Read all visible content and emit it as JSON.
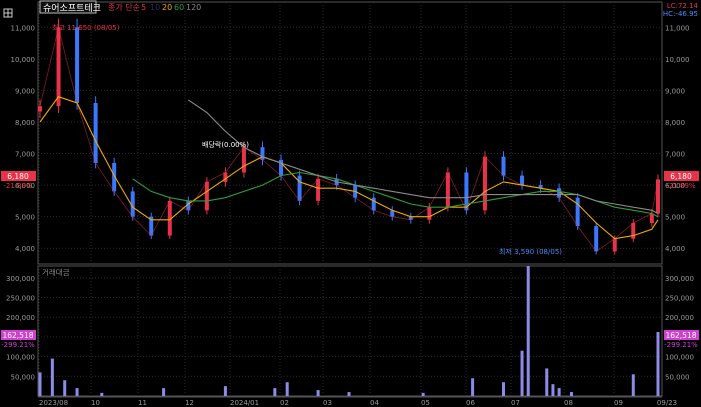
{
  "colors": {
    "background": "#000000",
    "panel_border": "#555555",
    "grid": "#2a2a2a",
    "axis_text": "#9a9a9a",
    "up": "#e8324a",
    "down": "#3a78ff",
    "ma5": "#e8324a",
    "ma20": "#f2a900",
    "ma60": "#2e9d3a",
    "ma120": "#8a8a8a",
    "volume": "#8c8ce8",
    "current_box": "#e8324a",
    "volume_box": "#d040d0",
    "high_label": "#e8324a",
    "low_label": "#4d8cff",
    "dividend_label": "#ffffff"
  },
  "header": {
    "icon": "grid-icon",
    "stock_name": "슈어소프트테크",
    "ma_caption": "종가 단순",
    "ma_periods": [
      "5",
      "10",
      "20",
      "60",
      "120"
    ],
    "lc_label": "LC:72.14",
    "hc_label": "HC:-46.95"
  },
  "price_panel": {
    "current_price_label": "6,180",
    "current_change_label": "-21.89%",
    "high_annotation": "최고 11,650 (08/05)",
    "low_annotation": "최저 3,590 (08/05)",
    "dividend_annotation": "배당락(0.00%)"
  },
  "volume_panel": {
    "title": "거래대금",
    "current_volume_label": "162,518",
    "current_volume_change": "-299.21%"
  },
  "chart_data": [
    {
      "type": "line",
      "title": "",
      "ylim": [
        3500,
        11800
      ],
      "y_ticks": [
        "4,000",
        "5,000",
        "6,000",
        "7,000",
        "8,000",
        "9,000",
        "10,000",
        "11,000"
      ],
      "x_ticks": [
        "2023/08",
        "10",
        "11",
        "12",
        "2024/01",
        "02",
        "03",
        "04",
        "05",
        "06",
        "07",
        "08",
        "09",
        "09/23"
      ],
      "x": [
        0,
        3,
        6,
        9,
        12,
        15,
        18,
        21,
        24,
        27,
        30,
        33,
        36,
        39,
        42,
        45,
        48,
        51,
        54,
        57,
        60,
        63,
        66,
        69,
        72,
        75,
        78,
        81,
        84,
        87,
        90,
        93,
        96,
        99,
        100
      ],
      "series": [
        {
          "name": "close",
          "values": [
            8500,
            11000,
            8600,
            6700,
            5800,
            5000,
            4400,
            5500,
            5200,
            6100,
            6400,
            7200,
            6800,
            6300,
            5500,
            6200,
            6000,
            5600,
            5200,
            5000,
            4900,
            5300,
            6400,
            5200,
            6900,
            6300,
            6000,
            5900,
            5600,
            4700,
            3900,
            4300,
            4800,
            5100,
            6180
          ]
        },
        {
          "name": "20",
          "values": [
            8000,
            8800,
            8600,
            7400,
            6300,
            5300,
            4900,
            4900,
            5400,
            5800,
            6200,
            6600,
            6900,
            6700,
            6100,
            5900,
            5900,
            5800,
            5500,
            5200,
            5000,
            5000,
            5300,
            5300,
            5800,
            6100,
            6000,
            5900,
            5800,
            5400,
            4800,
            4300,
            4400,
            4600,
            4900
          ]
        },
        {
          "name": "60",
          "values": [
            null,
            null,
            null,
            null,
            null,
            6200,
            5800,
            5600,
            5500,
            5500,
            5600,
            5800,
            6000,
            6300,
            6400,
            6300,
            6200,
            6000,
            5800,
            5600,
            5400,
            5300,
            5300,
            5400,
            5500,
            5600,
            5700,
            5800,
            5800,
            5700,
            5500,
            5300,
            5200,
            5100,
            5000
          ]
        },
        {
          "name": "120",
          "values": [
            null,
            null,
            null,
            null,
            null,
            null,
            null,
            null,
            8700,
            8300,
            7700,
            7200,
            6900,
            6700,
            6500,
            6300,
            6100,
            6000,
            5900,
            5800,
            5700,
            5600,
            5600,
            5600,
            5700,
            5700,
            5700,
            5700,
            5700,
            5700,
            5500,
            5400,
            5300,
            5200,
            5100
          ]
        }
      ]
    },
    {
      "type": "bar",
      "title": "거래대금",
      "ylim": [
        0,
        330000
      ],
      "y_ticks": [
        "50,000",
        "100,000",
        "150,000",
        "200,000",
        "250,000",
        "300,000"
      ],
      "x": [
        0,
        2,
        4,
        6,
        10,
        20,
        30,
        38,
        40,
        45,
        50,
        62,
        70,
        75,
        78,
        79,
        82,
        83,
        84,
        86,
        96,
        100
      ],
      "values": [
        60000,
        95000,
        40000,
        20000,
        8000,
        20000,
        25000,
        20000,
        35000,
        15000,
        10000,
        8000,
        45000,
        35000,
        115000,
        330000,
        70000,
        30000,
        20000,
        10000,
        55000,
        162518
      ]
    }
  ]
}
